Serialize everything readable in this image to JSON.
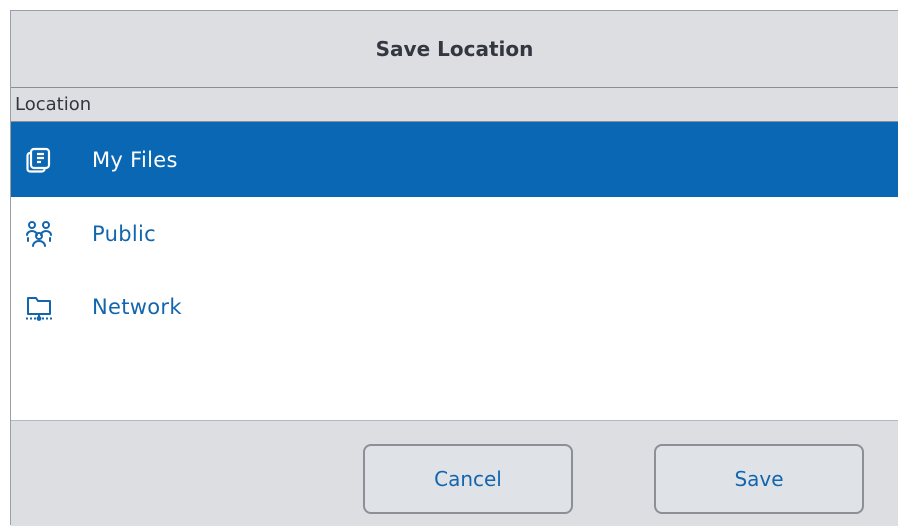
{
  "dialog": {
    "title": "Save Location"
  },
  "section": {
    "header": "Location"
  },
  "locations": [
    {
      "label": "My Files",
      "icon": "documents-icon",
      "selected": true
    },
    {
      "label": "Public",
      "icon": "people-group-icon",
      "selected": false
    },
    {
      "label": "Network",
      "icon": "network-folder-icon",
      "selected": false
    }
  ],
  "buttons": {
    "cancel_label": "Cancel",
    "save_label": "Save"
  },
  "colors": {
    "accent": "#0a67b3",
    "text_link": "#1366ad",
    "chrome": "#dcdee1"
  }
}
